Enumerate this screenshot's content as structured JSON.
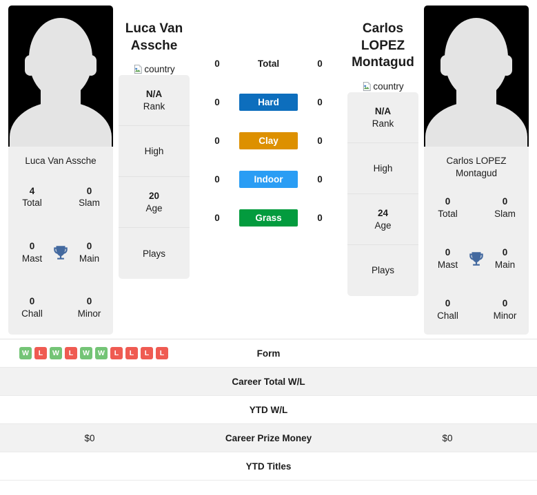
{
  "players": {
    "left": {
      "full_name": "Luca Van Assche",
      "name_line1": "Luca Van",
      "name_line2": "Assche",
      "country_alt": "country",
      "titles": {
        "total": "4",
        "slam": "0",
        "mast": "0",
        "main": "0",
        "chall": "0",
        "minor": "0"
      },
      "labels": {
        "total": "Total",
        "slam": "Slam",
        "mast": "Mast",
        "main": "Main",
        "chall": "Chall",
        "minor": "Minor"
      },
      "info": {
        "rank_value": "N/A",
        "rank_label": "Rank",
        "high_value": "",
        "high_label": "High",
        "age_value": "20",
        "age_label": "Age",
        "plays_value": "",
        "plays_label": "Plays"
      },
      "surface_wins": {
        "total": "0",
        "hard": "0",
        "clay": "0",
        "indoor": "0",
        "grass": "0"
      },
      "form": [
        "W",
        "L",
        "W",
        "L",
        "W",
        "W",
        "L",
        "L",
        "L",
        "L"
      ],
      "career_total_wl": "",
      "ytd_wl": "",
      "career_prize_money": "$0",
      "ytd_titles": ""
    },
    "right": {
      "full_name": "Carlos LOPEZ Montagud",
      "name_line1": "Carlos LOPEZ",
      "name_line2": "Montagud",
      "country_alt": "country",
      "titles": {
        "total": "0",
        "slam": "0",
        "mast": "0",
        "main": "0",
        "chall": "0",
        "minor": "0"
      },
      "labels": {
        "total": "Total",
        "slam": "Slam",
        "mast": "Mast",
        "main": "Main",
        "chall": "Chall",
        "minor": "Minor"
      },
      "info": {
        "rank_value": "N/A",
        "rank_label": "Rank",
        "high_value": "",
        "high_label": "High",
        "age_value": "24",
        "age_label": "Age",
        "plays_value": "",
        "plays_label": "Plays"
      },
      "surface_wins": {
        "total": "0",
        "hard": "0",
        "clay": "0",
        "indoor": "0",
        "grass": "0"
      },
      "form": [],
      "career_total_wl": "",
      "ytd_wl": "",
      "career_prize_money": "$0",
      "ytd_titles": ""
    }
  },
  "surfaces": {
    "total_label": "Total",
    "hard_label": "Hard",
    "clay_label": "Clay",
    "indoor_label": "Indoor",
    "grass_label": "Grass",
    "colors": {
      "hard": "#0d6ebd",
      "clay": "#dd9000",
      "indoor": "#2a9df4",
      "grass": "#039b3e"
    }
  },
  "table": {
    "rows": [
      {
        "label": "Form",
        "left": "",
        "right": ""
      },
      {
        "label": "Career Total W/L",
        "left": "",
        "right": ""
      },
      {
        "label": "YTD W/L",
        "left": "",
        "right": ""
      },
      {
        "label": "Career Prize Money",
        "left": "$0",
        "right": "$0"
      },
      {
        "label": "YTD Titles",
        "left": "",
        "right": ""
      }
    ]
  },
  "colors": {
    "form_win": "#74c476",
    "form_loss": "#ef5b52",
    "card_bg": "#efefef",
    "trophy": "#43699f"
  }
}
